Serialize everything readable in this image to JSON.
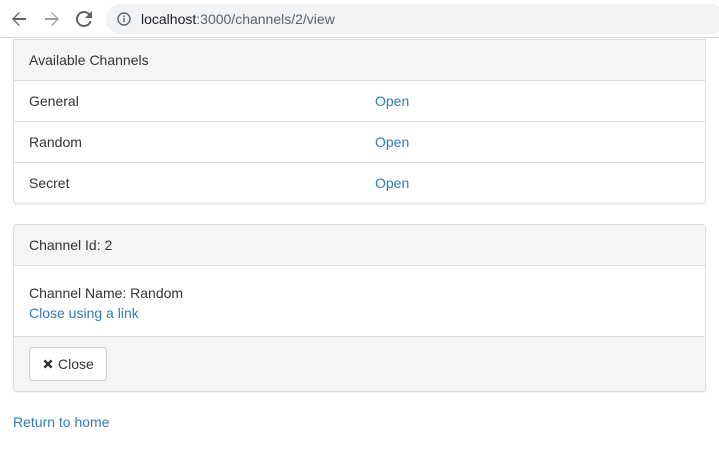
{
  "browser": {
    "url_host": "localhost",
    "url_rest": ":3000/channels/2/view",
    "icons": {
      "back": "arrow-left-icon",
      "forward": "arrow-right-icon",
      "reload": "reload-icon",
      "info": "info-circle-icon"
    }
  },
  "channels_panel": {
    "heading": "Available Channels",
    "channels": [
      {
        "name": "General",
        "action": "Open"
      },
      {
        "name": "Random",
        "action": "Open"
      },
      {
        "name": "Secret",
        "action": "Open"
      }
    ]
  },
  "detail_panel": {
    "heading": "Channel Id: 2",
    "channel_name_line": "Channel Name: Random",
    "close_link": "Close using a link",
    "close_button": "Close",
    "close_icon": "remove-x-icon"
  },
  "return_link": "Return to home",
  "colors": {
    "link": "#337ab7",
    "panel_heading_bg": "#f5f5f5",
    "border": "#dddddd",
    "text": "#333333"
  }
}
